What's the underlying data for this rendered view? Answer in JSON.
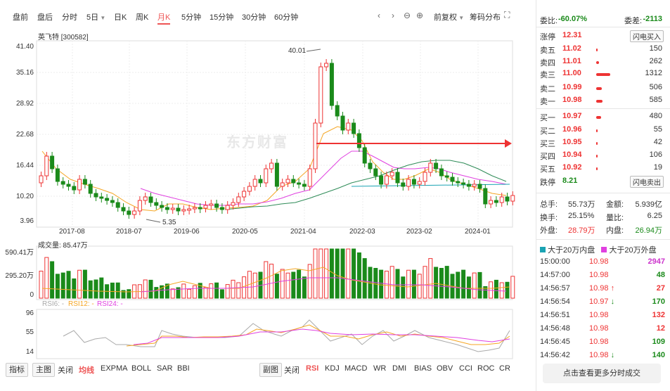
{
  "top_tabs": [
    "盘前",
    "盘后",
    "分时",
    "5日",
    "日K",
    "周K",
    "月K",
    "5分钟",
    "15分钟",
    "30分钟",
    "60分钟"
  ],
  "active_tab": "月K",
  "toolbar": {
    "fuquan": "前复权",
    "chouma": "筹码分布"
  },
  "stock": {
    "name": "英飞特 [300582]"
  },
  "chart_data": {
    "type": "candlestick",
    "y_ticks": [
      "41.40",
      "35.16",
      "28.92",
      "22.68",
      "16.44",
      "10.20",
      "3.96"
    ],
    "x_ticks": [
      "2017-08",
      "2018-07",
      "2019-06",
      "2020-05",
      "2021-04",
      "2022-03",
      "2023-02",
      "2024-01"
    ],
    "max_label": "40.01",
    "min_label": "5.35",
    "volume_title": "成交量: 85.47万",
    "volume_ticks": [
      "590.41万",
      "295.20万",
      "0"
    ],
    "rsi_title": [
      "RSI6: -",
      "RSI12: -",
      "RSI24: -"
    ],
    "rsi_ticks": [
      "96",
      "55",
      "14"
    ],
    "watermark": "东方财富"
  },
  "indicator_left": {
    "label": "指标",
    "main": "主图",
    "close": "关闭",
    "items": [
      "均线",
      "EXPMA",
      "BOLL",
      "SAR",
      "BBI"
    ],
    "active": "均线"
  },
  "indicator_right": {
    "label": "副图",
    "close": "关闭",
    "items": [
      "RSI",
      "KDJ",
      "MACD",
      "WR",
      "DMI",
      "BIAS",
      "OBV",
      "CCI",
      "ROC",
      "CR"
    ],
    "active": "RSI"
  },
  "panel": {
    "weibi_label": "委比:",
    "weibi": "-60.07%",
    "weicha_label": "委差:",
    "weicha": "-2113",
    "zhangting_label": "涨停",
    "zhangting": "12.31",
    "buy_btn": "闪电买入",
    "asks": [
      {
        "label": "卖五",
        "price": "11.02",
        "vol": "150"
      },
      {
        "label": "卖四",
        "price": "11.01",
        "vol": "262"
      },
      {
        "label": "卖三",
        "price": "11.00",
        "vol": "1312"
      },
      {
        "label": "卖二",
        "price": "10.99",
        "vol": "506"
      },
      {
        "label": "卖一",
        "price": "10.98",
        "vol": "585"
      }
    ],
    "bids": [
      {
        "label": "买一",
        "price": "10.97",
        "vol": "480"
      },
      {
        "label": "买二",
        "price": "10.96",
        "vol": "55"
      },
      {
        "label": "买三",
        "price": "10.95",
        "vol": "42"
      },
      {
        "label": "买四",
        "price": "10.94",
        "vol": "106"
      },
      {
        "label": "买五",
        "price": "10.92",
        "vol": "19"
      }
    ],
    "dieting_label": "跌停",
    "dieting": "8.21",
    "sell_btn": "闪电卖出",
    "stats": [
      {
        "l1": "总手:",
        "v1": "55.73万",
        "l2": "金额:",
        "v2": "5.939亿"
      },
      {
        "l1": "换手:",
        "v1": "25.15%",
        "l2": "量比:",
        "v2": "6.25"
      },
      {
        "l1": "外盘:",
        "v1": "28.79万",
        "l2": "内盘:",
        "v2": "26.94万"
      }
    ],
    "legend_in": "大于20万内盘",
    "legend_out": "大于20万外盘",
    "ticks": [
      {
        "time": "15:00:00",
        "price": "10.98",
        "arrow": "",
        "vol": "2947",
        "color": "#cc33cc"
      },
      {
        "time": "14:57:00",
        "price": "10.98",
        "arrow": "",
        "vol": "48",
        "color": "#1a8a1a"
      },
      {
        "time": "14:56:57",
        "price": "10.98",
        "arrow": "↑",
        "vol": "27",
        "color": "#e33"
      },
      {
        "time": "14:56:54",
        "price": "10.97",
        "arrow": "↓",
        "vol": "170",
        "color": "#1a8a1a"
      },
      {
        "time": "14:56:51",
        "price": "10.98",
        "arrow": "",
        "vol": "132",
        "color": "#e33"
      },
      {
        "time": "14:56:48",
        "price": "10.98",
        "arrow": "",
        "vol": "12",
        "color": "#e33"
      },
      {
        "time": "14:56:45",
        "price": "10.98",
        "arrow": "",
        "vol": "109",
        "color": "#1a8a1a"
      },
      {
        "time": "14:56:42",
        "price": "10.98",
        "arrow": "↓",
        "vol": "140",
        "color": "#1a8a1a"
      }
    ],
    "more_btn": "点击查看更多分时成交"
  }
}
